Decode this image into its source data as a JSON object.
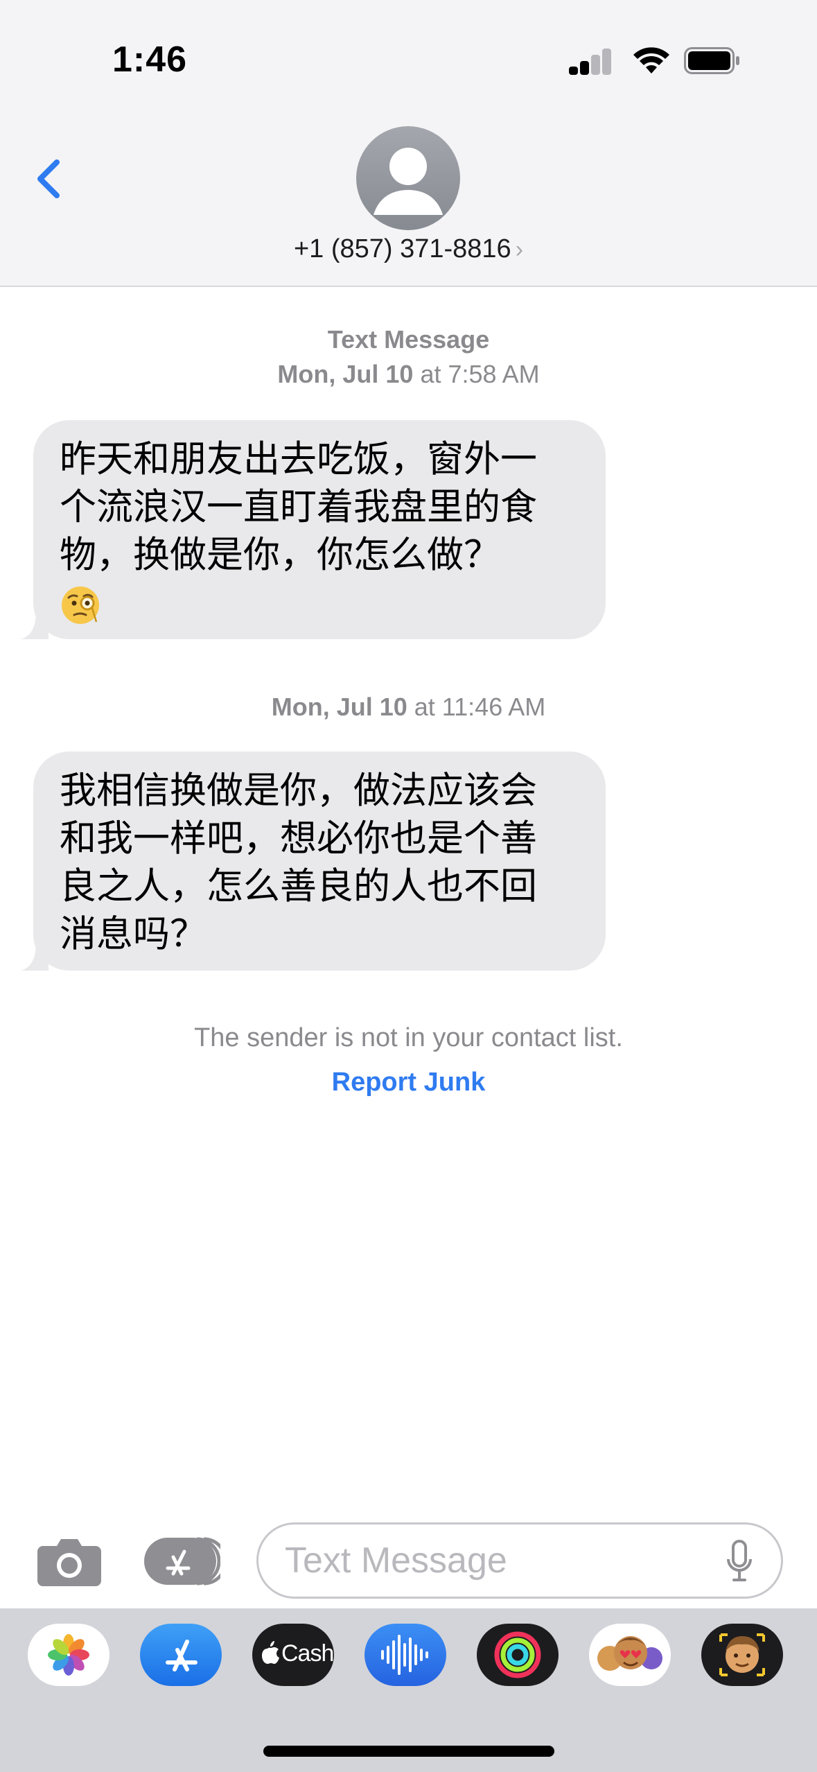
{
  "status_bar": {
    "time": "1:46"
  },
  "header": {
    "contact": "+1 (857) 371-8816"
  },
  "conversation": {
    "service_label": "Text Message",
    "first_day": "Mon, Jul 10",
    "first_time": "at 7:58 AM",
    "messages": [
      {
        "lines": [
          "昨天和朋友出去吃饭，窗外一",
          "个流浪汉一直盯着我盘里的食",
          "物，换做是你，你怎么做？"
        ],
        "emoji": "face-with-monocle"
      },
      {
        "lines": [
          "我相信换做是你，做法应该会",
          "和我一样吧，想必你也是个善",
          "良之人，怎么善良的人也不回",
          "消息吗？"
        ]
      }
    ],
    "second_day": "Mon, Jul 10",
    "second_time": "at 11:46 AM",
    "sender_notice": "The sender is not in your contact list.",
    "report_label": "Report Junk"
  },
  "compose": {
    "placeholder": "Text Message"
  },
  "app_drawer": {
    "cash_label": "Cash",
    "apps": [
      "photos-icon",
      "app-store-icon",
      "apple-cash-icon",
      "audio-message-icon",
      "activity-icon",
      "memoji-stickers-icon",
      "memoji-icon"
    ]
  },
  "colors": {
    "accent": "#2f7bf0",
    "bubble": "#e9e9eb",
    "meta_text": "#8a8a8e"
  }
}
